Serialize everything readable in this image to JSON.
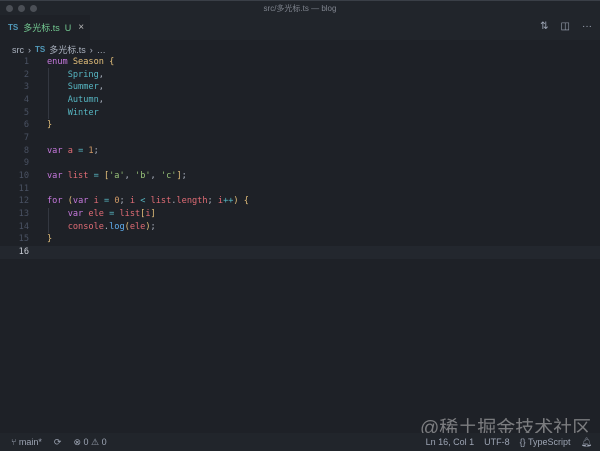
{
  "window": {
    "title": "src/多光标.ts — blog"
  },
  "tab": {
    "lang_badge": "TS",
    "name": "多光标.ts",
    "status": "U",
    "close": "×"
  },
  "editor_actions": {
    "compare": "⇅",
    "split": "◫",
    "more": "···"
  },
  "breadcrumb": {
    "folder": "src",
    "sep": "›",
    "lang_badge": "TS",
    "file": "多光标.ts",
    "more": "…"
  },
  "code": {
    "current_line": 16,
    "lines": [
      [
        [
          "enum ",
          "kw"
        ],
        [
          "Season ",
          "ty"
        ],
        [
          "{",
          "br"
        ]
      ],
      [
        [
          "    Spring",
          "mem"
        ],
        [
          ",",
          "pl"
        ]
      ],
      [
        [
          "    Summer",
          "mem"
        ],
        [
          ",",
          "pl"
        ]
      ],
      [
        [
          "    Autumn",
          "mem"
        ],
        [
          ",",
          "pl"
        ]
      ],
      [
        [
          "    Winter",
          "mem"
        ]
      ],
      [
        [
          "}",
          "br"
        ]
      ],
      [],
      [
        [
          "var ",
          "kw"
        ],
        [
          "a ",
          "var"
        ],
        [
          "= ",
          "op"
        ],
        [
          "1",
          "num"
        ],
        [
          ";",
          "pl"
        ]
      ],
      [],
      [
        [
          "var ",
          "kw"
        ],
        [
          "list ",
          "var"
        ],
        [
          "= ",
          "op"
        ],
        [
          "[",
          "br"
        ],
        [
          "'a'",
          "str"
        ],
        [
          ", ",
          "pl"
        ],
        [
          "'b'",
          "str"
        ],
        [
          ", ",
          "pl"
        ],
        [
          "'c'",
          "str"
        ],
        [
          "]",
          "br"
        ],
        [
          ";",
          "pl"
        ]
      ],
      [],
      [
        [
          "for ",
          "kw"
        ],
        [
          "(",
          "br"
        ],
        [
          "var ",
          "kw"
        ],
        [
          "i ",
          "var"
        ],
        [
          "= ",
          "op"
        ],
        [
          "0",
          "num"
        ],
        [
          "; ",
          "pl"
        ],
        [
          "i ",
          "var"
        ],
        [
          "< ",
          "op"
        ],
        [
          "list",
          "var"
        ],
        [
          ".",
          "pl"
        ],
        [
          "length",
          "var"
        ],
        [
          "; ",
          "pl"
        ],
        [
          "i",
          "var"
        ],
        [
          "++",
          "op"
        ],
        [
          ") ",
          "br"
        ],
        [
          "{",
          "br"
        ]
      ],
      [
        [
          "    var ",
          "kw"
        ],
        [
          "ele ",
          "var"
        ],
        [
          "= ",
          "op"
        ],
        [
          "list",
          "var"
        ],
        [
          "[",
          "br"
        ],
        [
          "i",
          "var"
        ],
        [
          "]",
          "br"
        ]
      ],
      [
        [
          "    console",
          "var"
        ],
        [
          ".",
          "pl"
        ],
        [
          "log",
          "fn"
        ],
        [
          "(",
          "br"
        ],
        [
          "ele",
          "var"
        ],
        [
          ")",
          "br"
        ],
        [
          ";",
          "pl"
        ]
      ],
      [
        [
          "}",
          "br"
        ]
      ],
      []
    ]
  },
  "status": {
    "branch": "main*",
    "errors": "0",
    "warnings": "0",
    "position": "Ln 16, Col 1",
    "encoding": "UTF-8",
    "language": "TypeScript"
  },
  "watermark": "@稀土掘金技术社区",
  "colors": {
    "bg": "#1e2127",
    "keyword": "#c678dd",
    "type": "#e5c07b",
    "member": "#56b6c2",
    "variable": "#e06c75",
    "number": "#d19a66",
    "string": "#98c379",
    "function": "#61afef"
  }
}
